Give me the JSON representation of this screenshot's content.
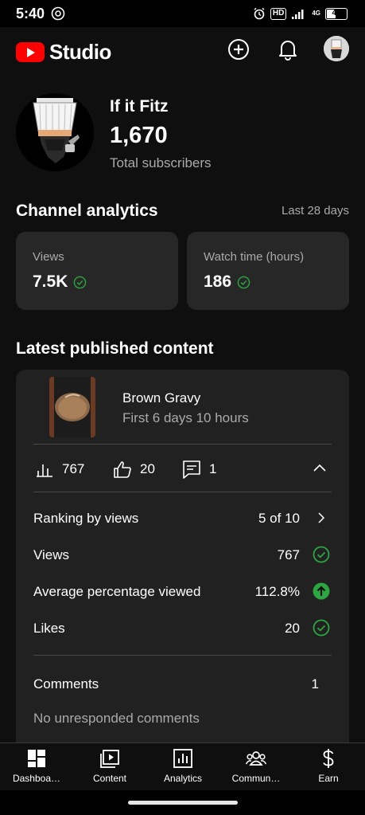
{
  "status_bar": {
    "time": "5:40",
    "hd": "HD",
    "network": "4G",
    "battery": "42"
  },
  "app_bar": {
    "logo_text": "Studio"
  },
  "channel": {
    "name": "If it Fitz",
    "subscribers": "1,670",
    "subscribers_label": "Total subscribers"
  },
  "analytics": {
    "title": "Channel analytics",
    "range": "Last 28 days",
    "cards": [
      {
        "label": "Views",
        "value": "7.5K"
      },
      {
        "label": "Watch time (hours)",
        "value": "186"
      }
    ]
  },
  "latest": {
    "title": "Latest published content",
    "video_title": "Brown Gravy",
    "video_subtitle": "First 6 days 10 hours",
    "stats": {
      "views": "767",
      "likes": "20",
      "comments": "1"
    },
    "rows": [
      {
        "label": "Ranking by views",
        "value": "5 of 10"
      },
      {
        "label": "Views",
        "value": "767"
      },
      {
        "label": "Average percentage viewed",
        "value": "112.8%"
      },
      {
        "label": "Likes",
        "value": "20"
      }
    ],
    "comments_label": "Comments",
    "comments_value": "1",
    "no_unresponded": "No unresponded comments"
  },
  "nav": [
    {
      "label": "Dashboa…",
      "icon": "dashboard-icon"
    },
    {
      "label": "Content",
      "icon": "content-icon"
    },
    {
      "label": "Analytics",
      "icon": "analytics-icon"
    },
    {
      "label": "Commun…",
      "icon": "community-icon"
    },
    {
      "label": "Earn",
      "icon": "earn-icon"
    }
  ],
  "colors": {
    "accent_green": "#2ba640",
    "brand_red": "#ff0000",
    "card_bg": "#272727"
  }
}
